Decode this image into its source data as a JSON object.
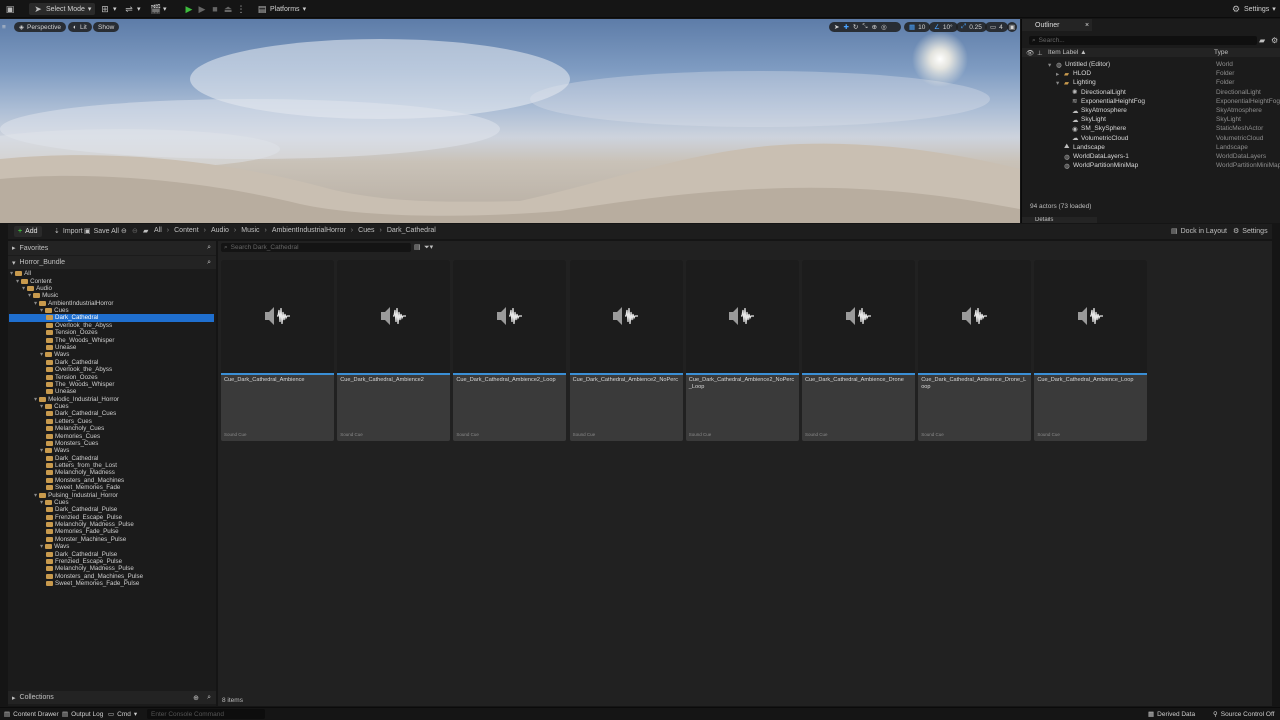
{
  "toolbar": {
    "select_mode": "Select Mode",
    "platforms": "Platforms",
    "settings": "Settings"
  },
  "viewport": {
    "perspective": "Perspective",
    "lit": "Lit",
    "show": "Show",
    "grid_snap": "10",
    "rot_snap": "10°",
    "scale_snap": "0.25",
    "cam_speed": "4"
  },
  "outliner": {
    "tab": "Outliner",
    "search_placeholder": "Search...",
    "col_label": "Item Label ▲",
    "col_type": "Type",
    "rows": [
      {
        "label": "Untitled (Editor)",
        "type": "World",
        "indent": 0,
        "icon": "world"
      },
      {
        "label": "HLOD",
        "type": "Folder",
        "indent": 1,
        "icon": "folder"
      },
      {
        "label": "Lighting",
        "type": "Folder",
        "indent": 1,
        "icon": "folder"
      },
      {
        "label": "DirectionalLight",
        "type": "DirectionalLight",
        "indent": 2,
        "icon": "light"
      },
      {
        "label": "ExponentialHeightFog",
        "type": "ExponentialHeightFog",
        "indent": 2,
        "icon": "fog"
      },
      {
        "label": "SkyAtmosphere",
        "type": "SkyAtmosphere",
        "indent": 2,
        "icon": "sky"
      },
      {
        "label": "SkyLight",
        "type": "SkyLight",
        "indent": 2,
        "icon": "sky"
      },
      {
        "label": "SM_SkySphere",
        "type": "StaticMeshActor",
        "indent": 2,
        "icon": "mesh"
      },
      {
        "label": "VolumetricCloud",
        "type": "VolumetricCloud",
        "indent": 2,
        "icon": "cloud"
      },
      {
        "label": "Landscape",
        "type": "Landscape",
        "indent": 1,
        "icon": "landscape"
      },
      {
        "label": "WorldDataLayers-1",
        "type": "WorldDataLayers",
        "indent": 1,
        "icon": "world"
      },
      {
        "label": "WorldPartitionMiniMap",
        "type": "WorldPartitionMiniMap",
        "indent": 1,
        "icon": "world"
      }
    ],
    "actor_count": "94 actors (73 loaded)",
    "details_tab": "Details"
  },
  "content_browser": {
    "add": "Add",
    "import": "Import",
    "save_all": "Save All",
    "breadcrumb": [
      "All",
      "Content",
      "Audio",
      "Music",
      "AmbientIndustrialHorror",
      "Cues",
      "Dark_Cathedral"
    ],
    "dock_in_layout": "Dock in Layout",
    "settings": "Settings",
    "search_placeholder": "Search Dark_Cathedral",
    "favorites": "Favorites",
    "bundle": "Horror_Bundle",
    "collections": "Collections",
    "item_count": "8 items",
    "tree": [
      {
        "label": "All",
        "indent": 0
      },
      {
        "label": "Content",
        "indent": 1
      },
      {
        "label": "Audio",
        "indent": 2
      },
      {
        "label": "Music",
        "indent": 3
      },
      {
        "label": "AmbientIndustrialHorror",
        "indent": 4
      },
      {
        "label": "Cues",
        "indent": 5
      },
      {
        "label": "Dark_Cathedral",
        "indent": 6,
        "selected": true
      },
      {
        "label": "Overlook_the_Abyss",
        "indent": 6
      },
      {
        "label": "Tension_Oozes",
        "indent": 6
      },
      {
        "label": "The_Woods_Whisper",
        "indent": 6
      },
      {
        "label": "Unease",
        "indent": 6
      },
      {
        "label": "Wavs",
        "indent": 5
      },
      {
        "label": "Dark_Cathedral",
        "indent": 6
      },
      {
        "label": "Overlook_the_Abyss",
        "indent": 6
      },
      {
        "label": "Tension_Oozes",
        "indent": 6
      },
      {
        "label": "The_Woods_Whisper",
        "indent": 6
      },
      {
        "label": "Unease",
        "indent": 6
      },
      {
        "label": "Melodic_Industrial_Horror",
        "indent": 4
      },
      {
        "label": "Cues",
        "indent": 5
      },
      {
        "label": "Dark_Cathedral_Cues",
        "indent": 6
      },
      {
        "label": "Letters_Cues",
        "indent": 6
      },
      {
        "label": "Melancholy_Cues",
        "indent": 6
      },
      {
        "label": "Memories_Cues",
        "indent": 6
      },
      {
        "label": "Monsters_Cues",
        "indent": 6
      },
      {
        "label": "Wavs",
        "indent": 5
      },
      {
        "label": "Dark_Cathedral",
        "indent": 6
      },
      {
        "label": "Letters_from_the_Lost",
        "indent": 6
      },
      {
        "label": "Melancholy_Madness",
        "indent": 6
      },
      {
        "label": "Monsters_and_Machines",
        "indent": 6
      },
      {
        "label": "Sweet_Memories_Fade",
        "indent": 6
      },
      {
        "label": "Pulsing_Industrial_Horror",
        "indent": 4
      },
      {
        "label": "Cues",
        "indent": 5
      },
      {
        "label": "Dark_Cathedral_Pulse",
        "indent": 6
      },
      {
        "label": "Frenzied_Escape_Pulse",
        "indent": 6
      },
      {
        "label": "Melancholy_Madness_Pulse",
        "indent": 6
      },
      {
        "label": "Memories_Fade_Pulse",
        "indent": 6
      },
      {
        "label": "Monster_Machines_Pulse",
        "indent": 6
      },
      {
        "label": "Wavs",
        "indent": 5
      },
      {
        "label": "Dark_Cathedral_Pulse",
        "indent": 6
      },
      {
        "label": "Frenzied_Escape_Pulse",
        "indent": 6
      },
      {
        "label": "Melancholy_Madness_Pulse",
        "indent": 6
      },
      {
        "label": "Monsters_and_Machines_Pulse",
        "indent": 6
      },
      {
        "label": "Sweet_Memories_Fade_Pulse",
        "indent": 6
      }
    ],
    "assets": [
      {
        "name": "Cue_Dark_Cathedral_Ambience",
        "type": "Sound Cue"
      },
      {
        "name": "Cue_Dark_Cathedral_Ambience2",
        "type": "Sound Cue"
      },
      {
        "name": "Cue_Dark_Cathedral_Ambience2_Loop",
        "type": "Sound Cue"
      },
      {
        "name": "Cue_Dark_Cathedral_Ambience2_NoPerc",
        "type": "Sound Cue"
      },
      {
        "name": "Cue_Dark_Cathedral_Ambience2_NoPerc_Loop",
        "type": "Sound Cue"
      },
      {
        "name": "Cue_Dark_Cathedral_Ambience_Drone",
        "type": "Sound Cue"
      },
      {
        "name": "Cue_Dark_Cathedral_Ambience_Drone_Loop",
        "type": "Sound Cue"
      },
      {
        "name": "Cue_Dark_Cathedral_Ambience_Loop",
        "type": "Sound Cue"
      }
    ]
  },
  "statusbar": {
    "content_drawer": "Content Drawer",
    "output_log": "Output Log",
    "cmd": "Cmd",
    "console_placeholder": "Enter Console Command",
    "derived_data": "Derived Data",
    "source_control": "Source Control Off"
  },
  "colors": {
    "selection": "#1f6fcf",
    "accent": "#3a8fd6",
    "folder": "#c89a4d",
    "play": "#3dbb3d"
  }
}
